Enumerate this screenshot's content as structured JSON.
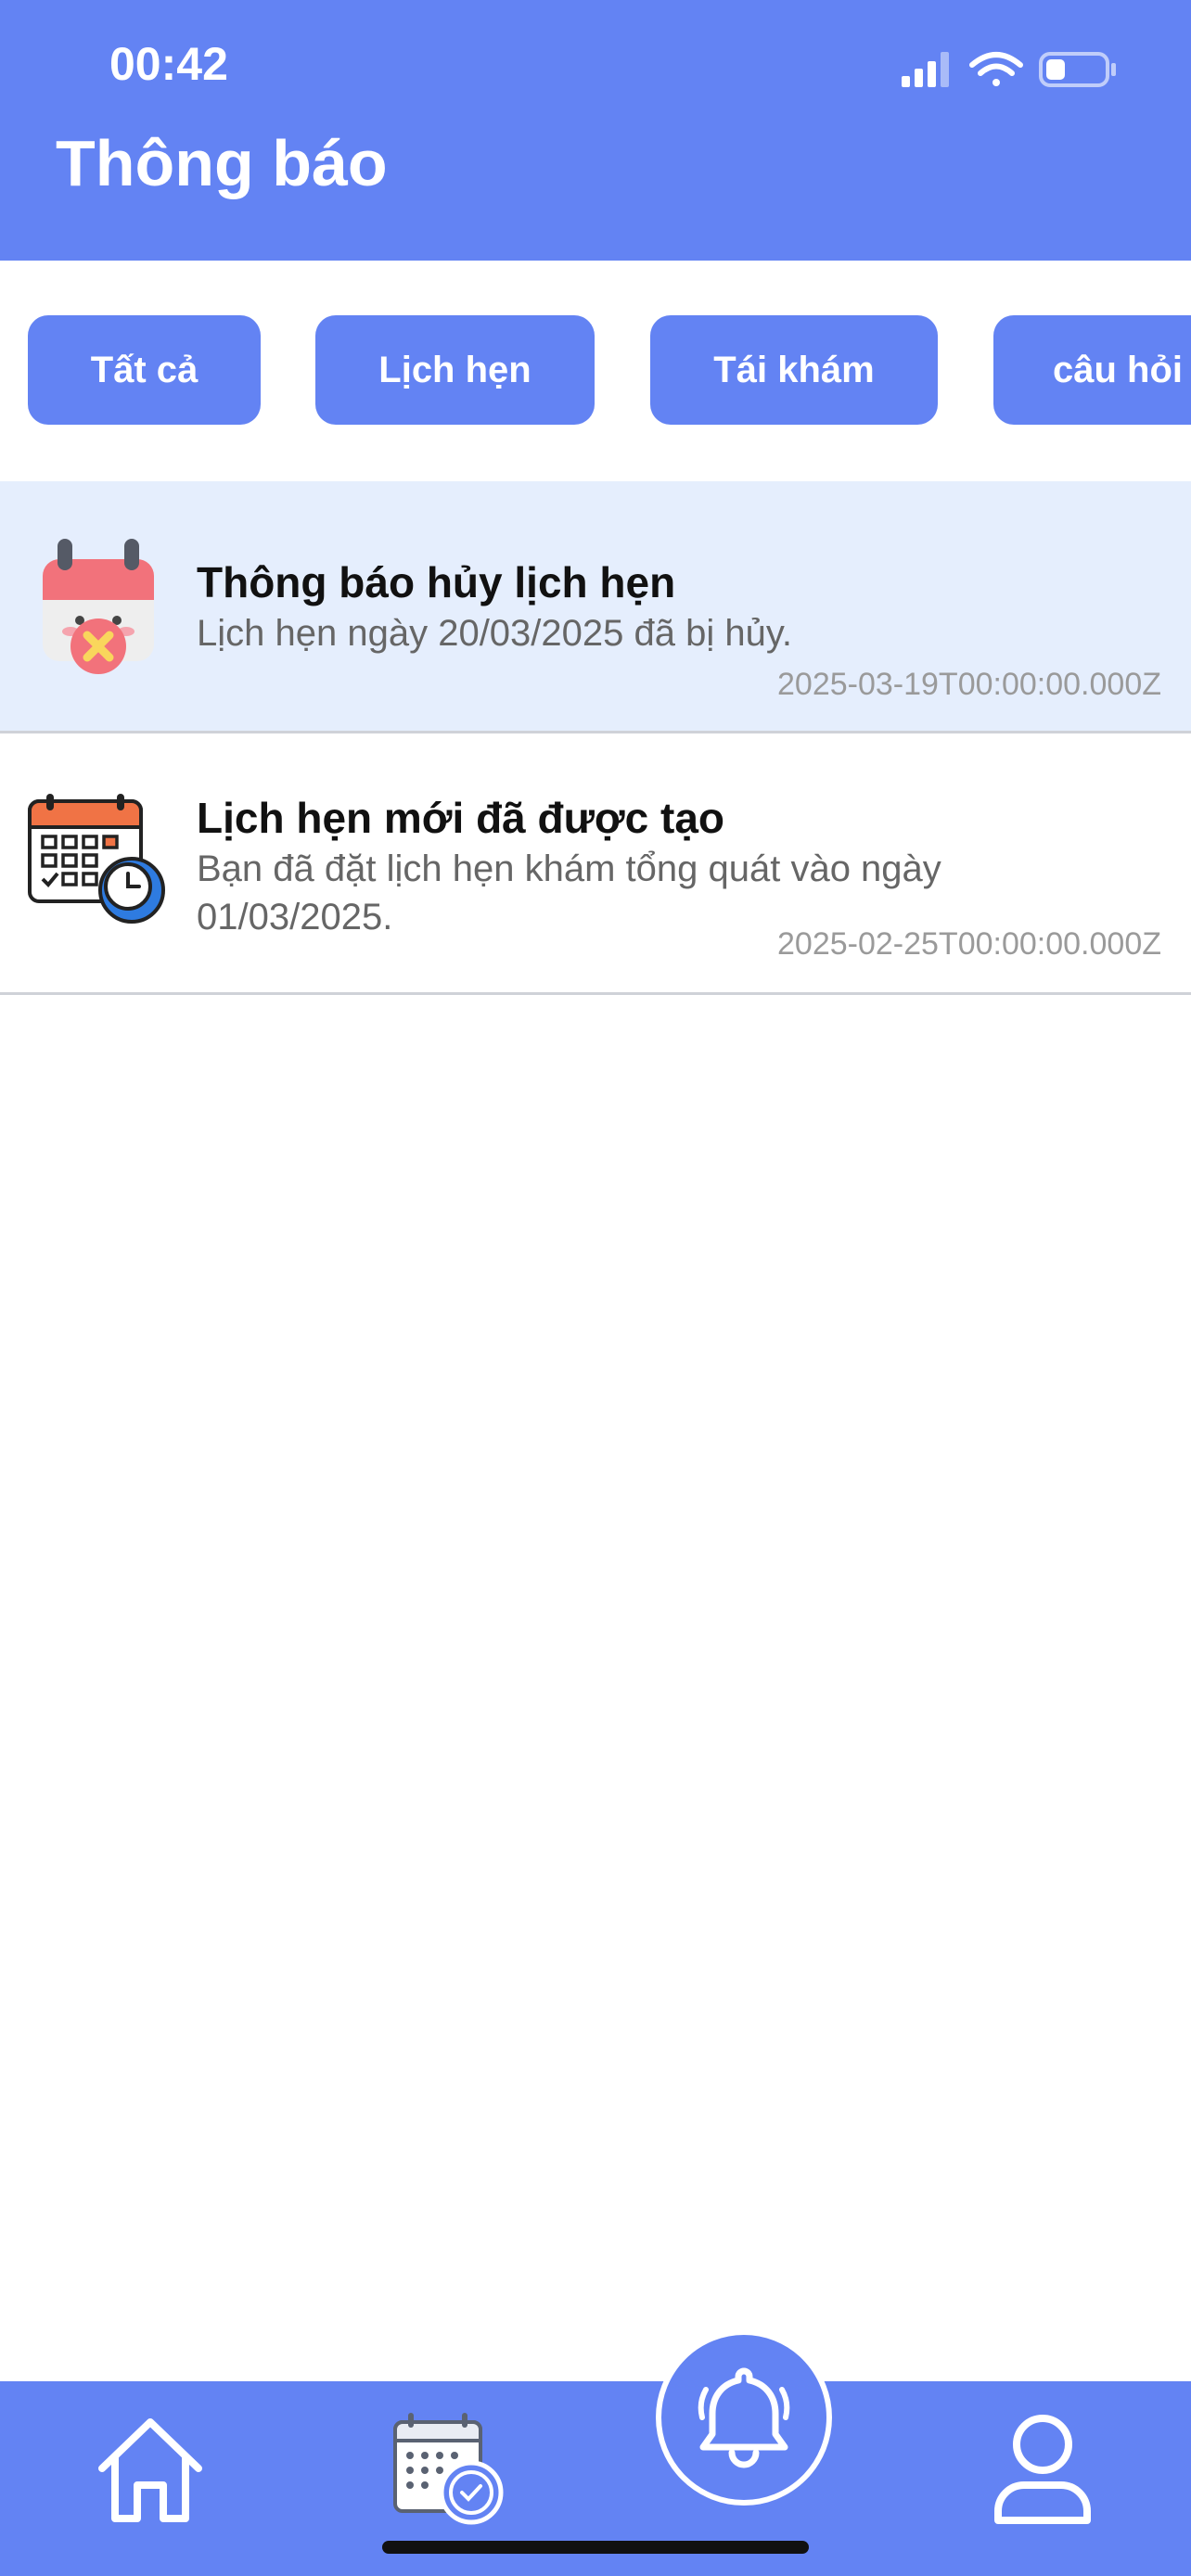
{
  "status_bar": {
    "time": "00:42"
  },
  "header": {
    "title": "Thông báo"
  },
  "filters": [
    {
      "label": "Tất cả"
    },
    {
      "label": "Lịch hẹn"
    },
    {
      "label": "Tái khám"
    },
    {
      "label": "câu hỏi"
    }
  ],
  "notifications": [
    {
      "title": "Thông báo hủy lịch hẹn",
      "body": "Lịch hẹn ngày 20/03/2025 đã bị hủy.",
      "time": "2025-03-19T00:00:00.000Z",
      "icon": "cancelled-calendar-icon",
      "unread": true
    },
    {
      "title": "Lịch hẹn mới đã được tạo",
      "body": "Bạn đã đặt lịch hẹn khám tổng quát vào ngày 01/03/2025.",
      "time": "2025-02-25T00:00:00.000Z",
      "icon": "calendar-clock-icon",
      "unread": false
    }
  ],
  "bottom_nav": [
    {
      "icon": "home-icon"
    },
    {
      "icon": "calendar-clock-icon"
    },
    {
      "icon": "bell-icon",
      "active": true
    },
    {
      "icon": "user-icon"
    }
  ],
  "colors": {
    "primary": "#6383F3",
    "unread_background": "#E5EEFD",
    "text_primary": "#111111",
    "text_secondary": "#666666",
    "text_muted": "#9A9A9A"
  }
}
